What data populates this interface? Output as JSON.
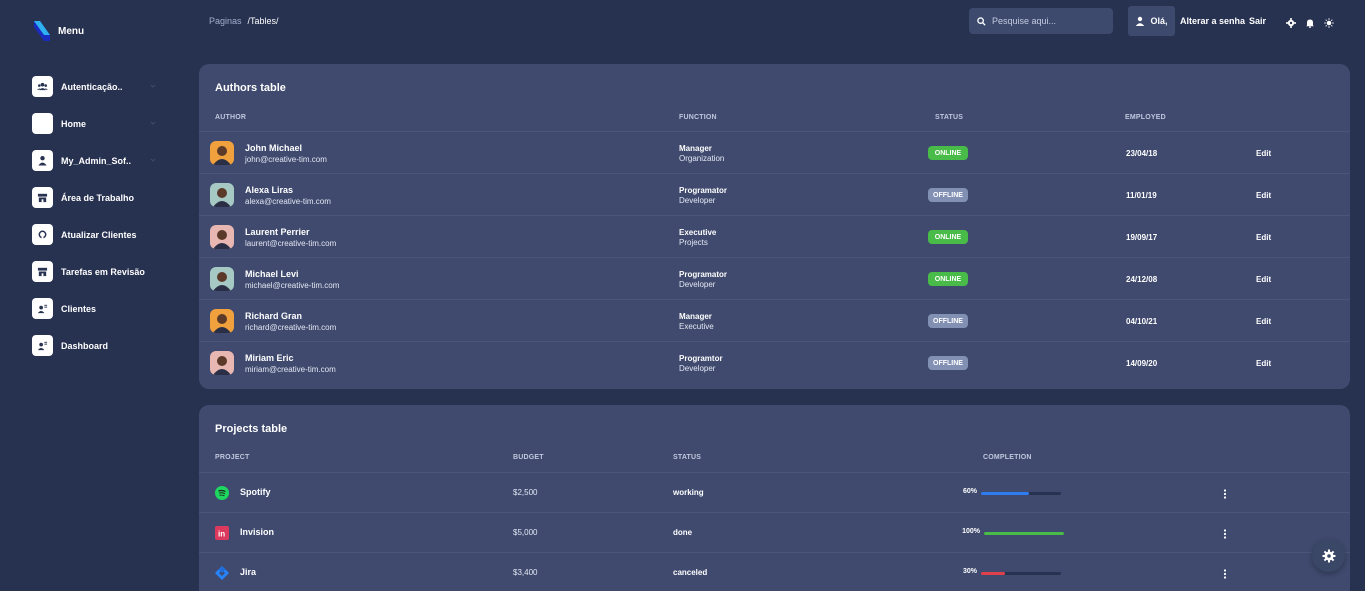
{
  "sidebar": {
    "brand": "Menu",
    "items": [
      {
        "label": "Autenticação..",
        "icon": "users-icon",
        "caret": true
      },
      {
        "label": "Home",
        "icon": "home-icon",
        "caret": true
      },
      {
        "label": "My_Admin_Sof..",
        "icon": "user-icon",
        "caret": true
      },
      {
        "label": "Área de Trabalho",
        "icon": "store-icon",
        "caret": false
      },
      {
        "label": "Atualizar Clientes",
        "icon": "refresh-icon",
        "caret": false
      },
      {
        "label": "Tarefas em Revisão",
        "icon": "store-icon",
        "caret": false
      },
      {
        "label": "Clientes",
        "icon": "clients-icon",
        "caret": false
      },
      {
        "label": "Dashboard",
        "icon": "clients-icon",
        "caret": false
      }
    ]
  },
  "header": {
    "breadcrumb_parent": "Paginas",
    "breadcrumb_current": "/Tables/",
    "search_placeholder": "Pesquise aqui...",
    "greeting": "Olá,",
    "change_password": "Alterar a senha",
    "logout": "Sair"
  },
  "authors": {
    "title": "Authors table",
    "columns": {
      "author": "AUTHOR",
      "function": "FUNCTION",
      "status": "STATUS",
      "employed": "EMPLOYED"
    },
    "rows": [
      {
        "name": "John Michael",
        "email": "john@creative-tim.com",
        "role": "Manager",
        "org": "Organization",
        "status": "ONLINE",
        "date": "23/04/18",
        "action": "Edit",
        "avatar_bg": "#f0a03c"
      },
      {
        "name": "Alexa Liras",
        "email": "alexa@creative-tim.com",
        "role": "Programator",
        "org": "Developer",
        "status": "OFFLINE",
        "date": "11/01/19",
        "action": "Edit",
        "avatar_bg": "#a6c9c4"
      },
      {
        "name": "Laurent Perrier",
        "email": "laurent@creative-tim.com",
        "role": "Executive",
        "org": "Projects",
        "status": "ONLINE",
        "date": "19/09/17",
        "action": "Edit",
        "avatar_bg": "#e8b7b2"
      },
      {
        "name": "Michael Levi",
        "email": "michael@creative-tim.com",
        "role": "Programator",
        "org": "Developer",
        "status": "ONLINE",
        "date": "24/12/08",
        "action": "Edit",
        "avatar_bg": "#a6c9c4"
      },
      {
        "name": "Richard Gran",
        "email": "richard@creative-tim.com",
        "role": "Manager",
        "org": "Executive",
        "status": "OFFLINE",
        "date": "04/10/21",
        "action": "Edit",
        "avatar_bg": "#f0a03c"
      },
      {
        "name": "Miriam Eric",
        "email": "miriam@creative-tim.com",
        "role": "Programtor",
        "org": "Developer",
        "status": "OFFLINE",
        "date": "14/09/20",
        "action": "Edit",
        "avatar_bg": "#e8b7b2"
      }
    ]
  },
  "projects": {
    "title": "Projects table",
    "columns": {
      "project": "PROJECT",
      "budget": "BUDGET",
      "status": "STATUS",
      "completion": "COMPLETION"
    },
    "rows": [
      {
        "name": "Spotify",
        "icon": "spotify-icon",
        "budget": "$2,500",
        "status": "working",
        "percent_label": "60%",
        "completion": 60,
        "bar_color": "#2f7cf0"
      },
      {
        "name": "Invision",
        "icon": "invision-icon",
        "budget": "$5,000",
        "status": "done",
        "percent_label": "100%",
        "completion": 100,
        "bar_color": "#48bb48"
      },
      {
        "name": "Jira",
        "icon": "jira-icon",
        "budget": "$3,400",
        "status": "canceled",
        "percent_label": "30%",
        "completion": 30,
        "bar_color": "#e0404a"
      }
    ]
  },
  "colors": {
    "background": "#273150",
    "card": "#3f4a6e",
    "online": "#48bb48",
    "offline": "#8290b4"
  }
}
